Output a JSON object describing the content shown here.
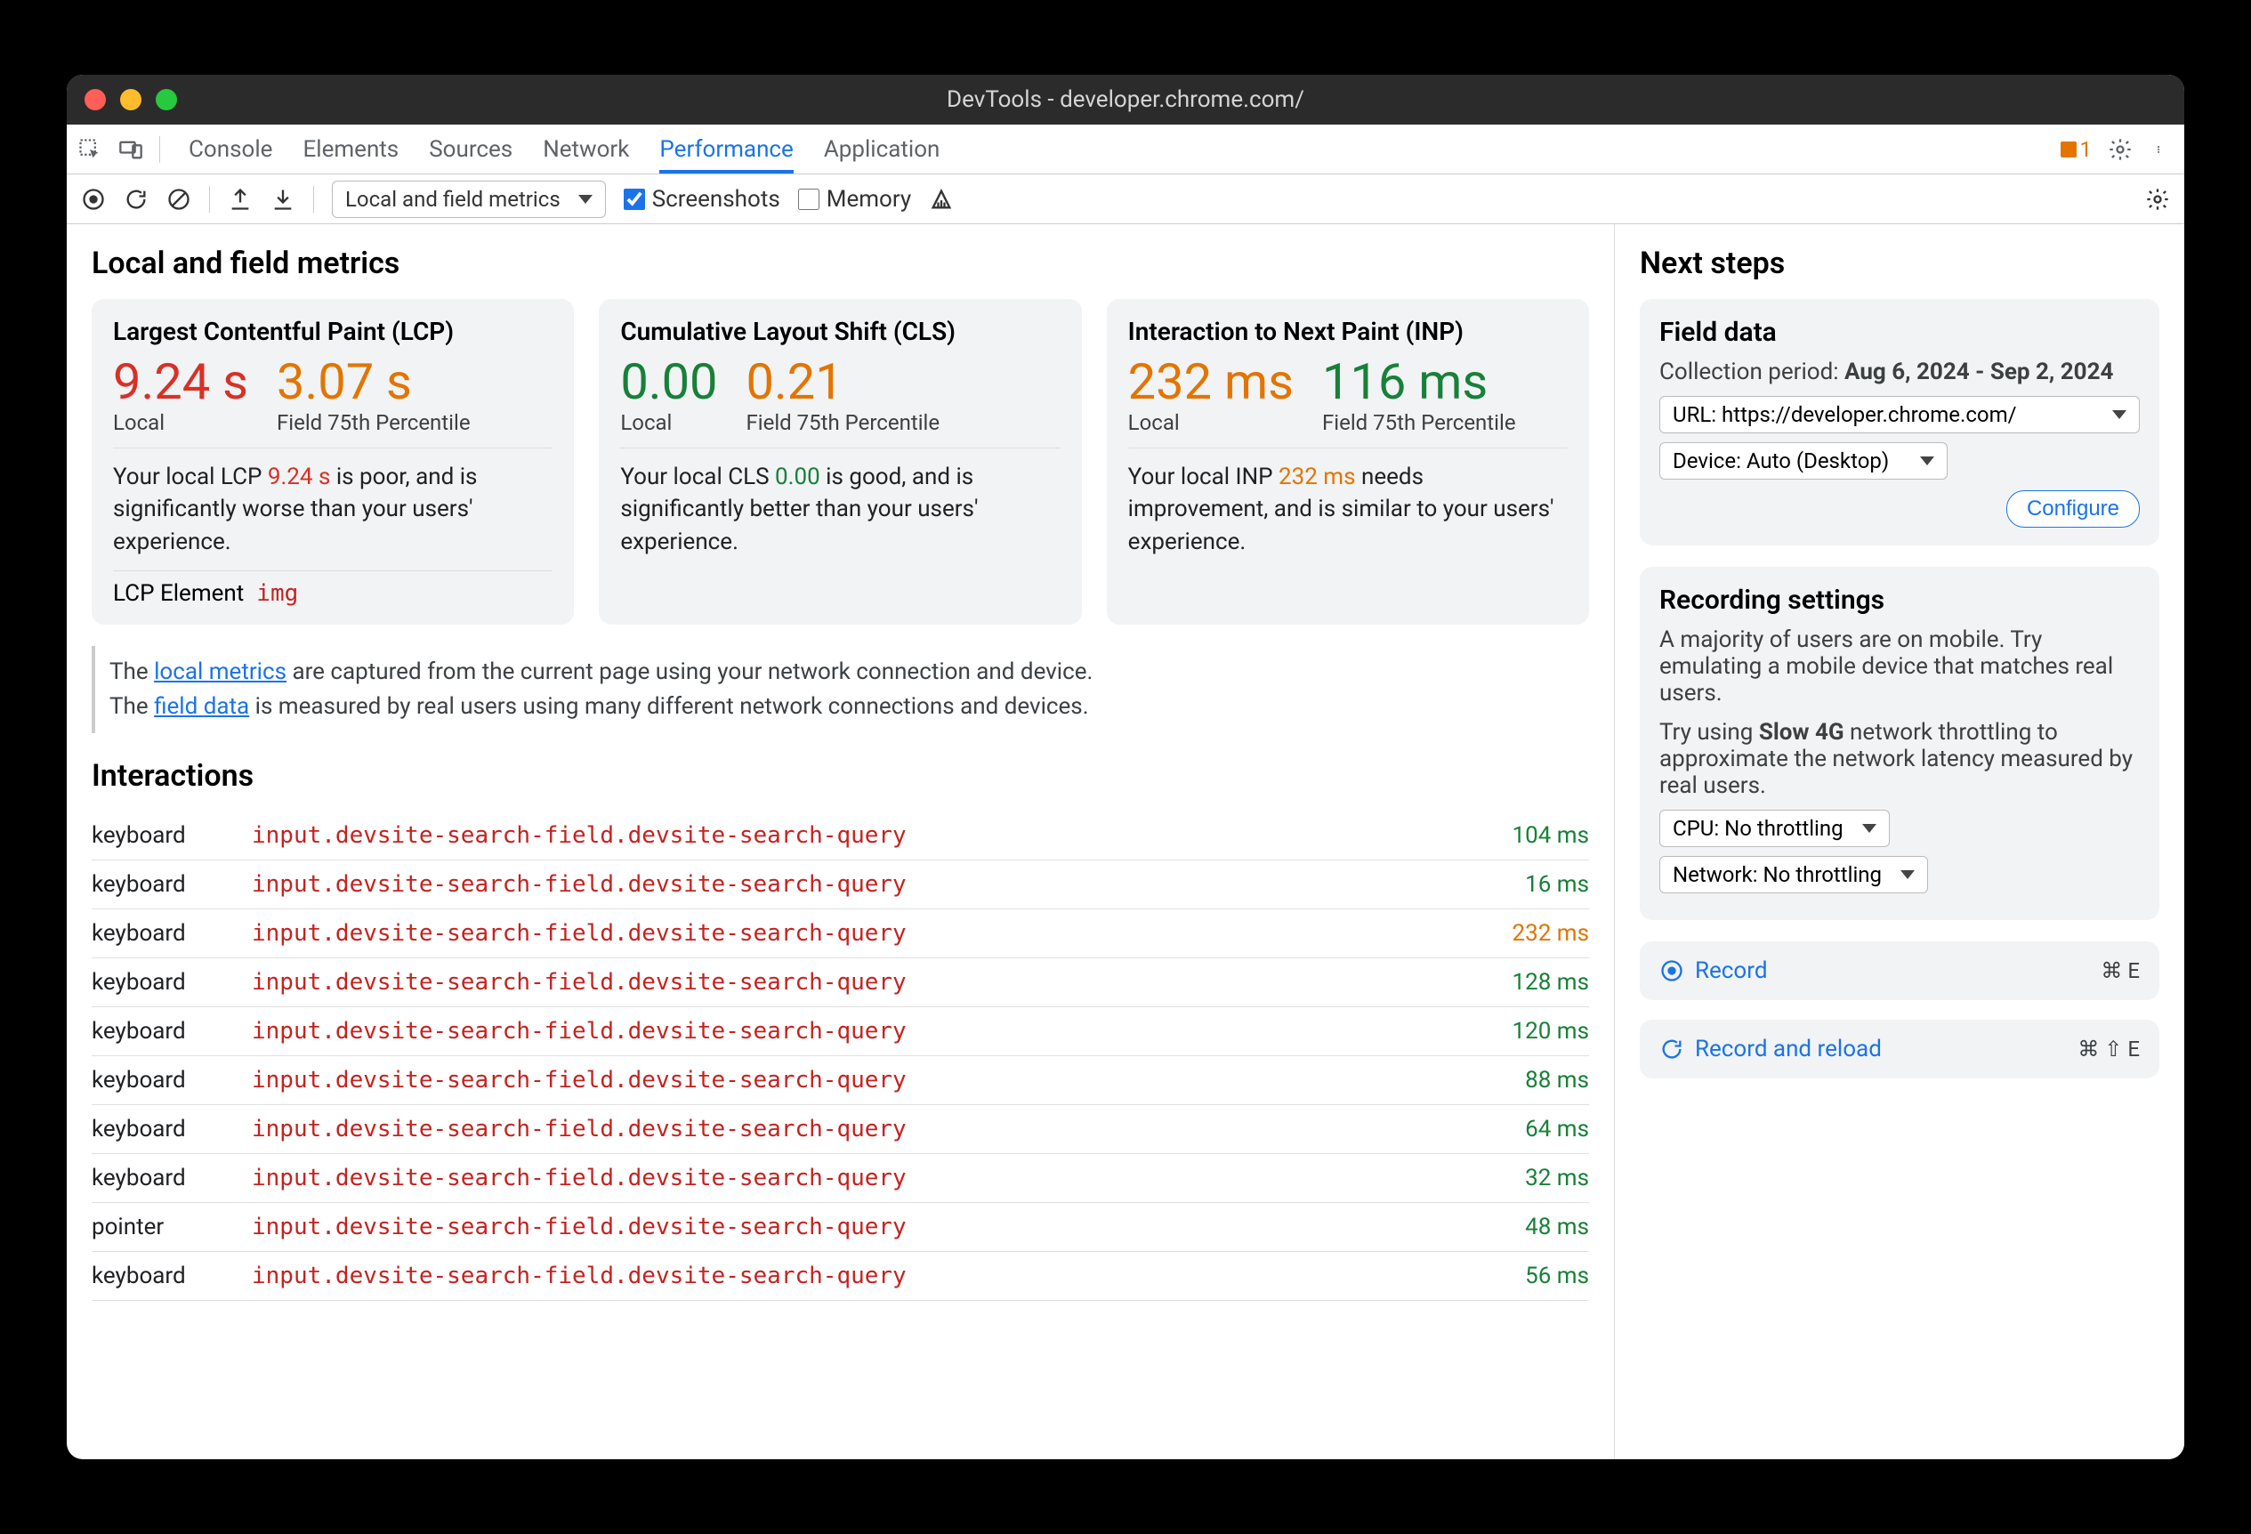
{
  "window": {
    "title": "DevTools - developer.chrome.com/"
  },
  "tabs": {
    "items": [
      "Console",
      "Elements",
      "Sources",
      "Network",
      "Performance",
      "Application"
    ],
    "active": "Performance",
    "warnings": "1"
  },
  "toolbar": {
    "mode_label": "Local and field metrics",
    "screenshots_label": "Screenshots",
    "screenshots_checked": true,
    "memory_label": "Memory",
    "memory_checked": false
  },
  "left": {
    "heading": "Local and field metrics",
    "cards": [
      {
        "title": "Largest Contentful Paint (LCP)",
        "local_value": "9.24 s",
        "local_class": "red",
        "local_label": "Local",
        "field_value": "3.07 s",
        "field_class": "orange",
        "field_label": "Field 75th Percentile",
        "desc_pre": "Your local LCP ",
        "desc_val": "9.24 s",
        "desc_val_class": "hl-red",
        "desc_post": " is poor, and is significantly worse than your users' experience.",
        "extra_label": "LCP Element",
        "extra_val": "img"
      },
      {
        "title": "Cumulative Layout Shift (CLS)",
        "local_value": "0.00",
        "local_class": "green",
        "local_label": "Local",
        "field_value": "0.21",
        "field_class": "orange",
        "field_label": "Field 75th Percentile",
        "desc_pre": "Your local CLS ",
        "desc_val": "0.00",
        "desc_val_class": "hl-green",
        "desc_post": " is good, and is significantly better than your users' experience."
      },
      {
        "title": "Interaction to Next Paint (INP)",
        "local_value": "232 ms",
        "local_class": "orange",
        "local_label": "Local",
        "field_value": "116 ms",
        "field_class": "green",
        "field_label": "Field 75th Percentile",
        "desc_pre": "Your local INP ",
        "desc_val": "232 ms",
        "desc_val_class": "hl-orange",
        "desc_post": " needs improvement, and is similar to your users' experience."
      }
    ],
    "info_line1_pre": "The ",
    "info_link1": "local metrics",
    "info_line1_post": " are captured from the current page using your network connection and device.",
    "info_line2_pre": "The ",
    "info_link2": "field data",
    "info_line2_post": " is measured by real users using many different network connections and devices.",
    "interactions_heading": "Interactions",
    "interactions": [
      {
        "type": "keyboard",
        "selector": "input.devsite-search-field.devsite-search-query",
        "dur": "104 ms",
        "dur_class": "green"
      },
      {
        "type": "keyboard",
        "selector": "input.devsite-search-field.devsite-search-query",
        "dur": "16 ms",
        "dur_class": "green"
      },
      {
        "type": "keyboard",
        "selector": "input.devsite-search-field.devsite-search-query",
        "dur": "232 ms",
        "dur_class": "orange"
      },
      {
        "type": "keyboard",
        "selector": "input.devsite-search-field.devsite-search-query",
        "dur": "128 ms",
        "dur_class": "green"
      },
      {
        "type": "keyboard",
        "selector": "input.devsite-search-field.devsite-search-query",
        "dur": "120 ms",
        "dur_class": "green"
      },
      {
        "type": "keyboard",
        "selector": "input.devsite-search-field.devsite-search-query",
        "dur": "88 ms",
        "dur_class": "green"
      },
      {
        "type": "keyboard",
        "selector": "input.devsite-search-field.devsite-search-query",
        "dur": "64 ms",
        "dur_class": "green"
      },
      {
        "type": "keyboard",
        "selector": "input.devsite-search-field.devsite-search-query",
        "dur": "32 ms",
        "dur_class": "green"
      },
      {
        "type": "pointer",
        "selector": "input.devsite-search-field.devsite-search-query",
        "dur": "48 ms",
        "dur_class": "green"
      },
      {
        "type": "keyboard",
        "selector": "input.devsite-search-field.devsite-search-query",
        "dur": "56 ms",
        "dur_class": "green"
      }
    ]
  },
  "right": {
    "heading": "Next steps",
    "field": {
      "title": "Field data",
      "period_label": "Collection period: ",
      "period_value": "Aug 6, 2024 - Sep 2, 2024",
      "url_dropdown": "URL: https://developer.chrome.com/",
      "device_dropdown": "Device: Auto (Desktop)",
      "configure": "Configure"
    },
    "rec_settings": {
      "title": "Recording settings",
      "p1_pre": "A majority of users are on mobile. Try emulating a mobile device that matches real users.",
      "p2_pre": "Try using ",
      "p2_bold": "Slow 4G",
      "p2_post": " network throttling to approximate the network latency measured by real users.",
      "cpu_dropdown": "CPU: No throttling",
      "net_dropdown": "Network: No throttling"
    },
    "record": {
      "label": "Record",
      "kbd": "⌘ E"
    },
    "record_reload": {
      "label": "Record and reload",
      "kbd": "⌘ ⇧ E"
    }
  }
}
